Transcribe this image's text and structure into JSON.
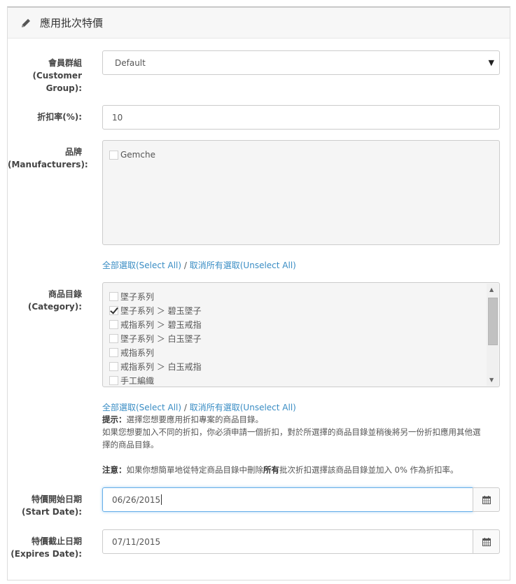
{
  "panel": {
    "title": "應用批次特價"
  },
  "customer_group": {
    "label_zh": "會員群組",
    "label_en_line1": "(Customer",
    "label_en_line2": "Group):",
    "selected": "Default"
  },
  "discount": {
    "label": "折扣率(%):",
    "value": "10"
  },
  "manufacturers": {
    "label_zh": "品牌",
    "label_en": "(Manufacturers):",
    "items": [
      {
        "label": "Gemche",
        "checked": false
      }
    ]
  },
  "select_links": {
    "select_all": "全部選取(Select All)",
    "separator": " / ",
    "unselect_all": "取消所有選取(Unselect All)"
  },
  "category": {
    "label_zh": "商品目錄",
    "label_en": "(Category):",
    "items": [
      {
        "label": "墜子系列",
        "checked": false
      },
      {
        "label": "墜子系列 ＞ 碧玉墜子",
        "checked": true
      },
      {
        "label": "戒指系列 ＞ 碧玉戒指",
        "checked": false
      },
      {
        "label": "墜子系列 ＞ 白玉墜子",
        "checked": false
      },
      {
        "label": "戒指系列",
        "checked": false
      },
      {
        "label": "戒指系列 ＞ 白玉戒指",
        "checked": false
      },
      {
        "label": "手工編織",
        "checked": false
      }
    ]
  },
  "help": {
    "tip_label": "提示：",
    "tip_text": "選擇您想要應用折扣專案的商品目錄。",
    "line2": "如果您想要加入不同的折扣，你必須申請一個折扣，對於所選擇的商品目錄並稍後將另一份折扣應用其他選",
    "line3": "擇的商品目錄。",
    "note_label": "注意：",
    "note_text1": "如果你想簡單地從特定商品目錄中刪除",
    "note_bold": "所有",
    "note_text2": "批次折扣選擇該商品目錄並加入 0% 作為折扣率。"
  },
  "start_date": {
    "label_zh": "特價開始日期",
    "label_en": "(Start Date):",
    "value": "06/26/2015"
  },
  "expire_date": {
    "label_zh": "特價截止日期",
    "label_en": "(Expires Date):",
    "value": "07/11/2015"
  },
  "icons": {
    "edit": "pencil-icon",
    "calendar": "calendar-icon"
  }
}
